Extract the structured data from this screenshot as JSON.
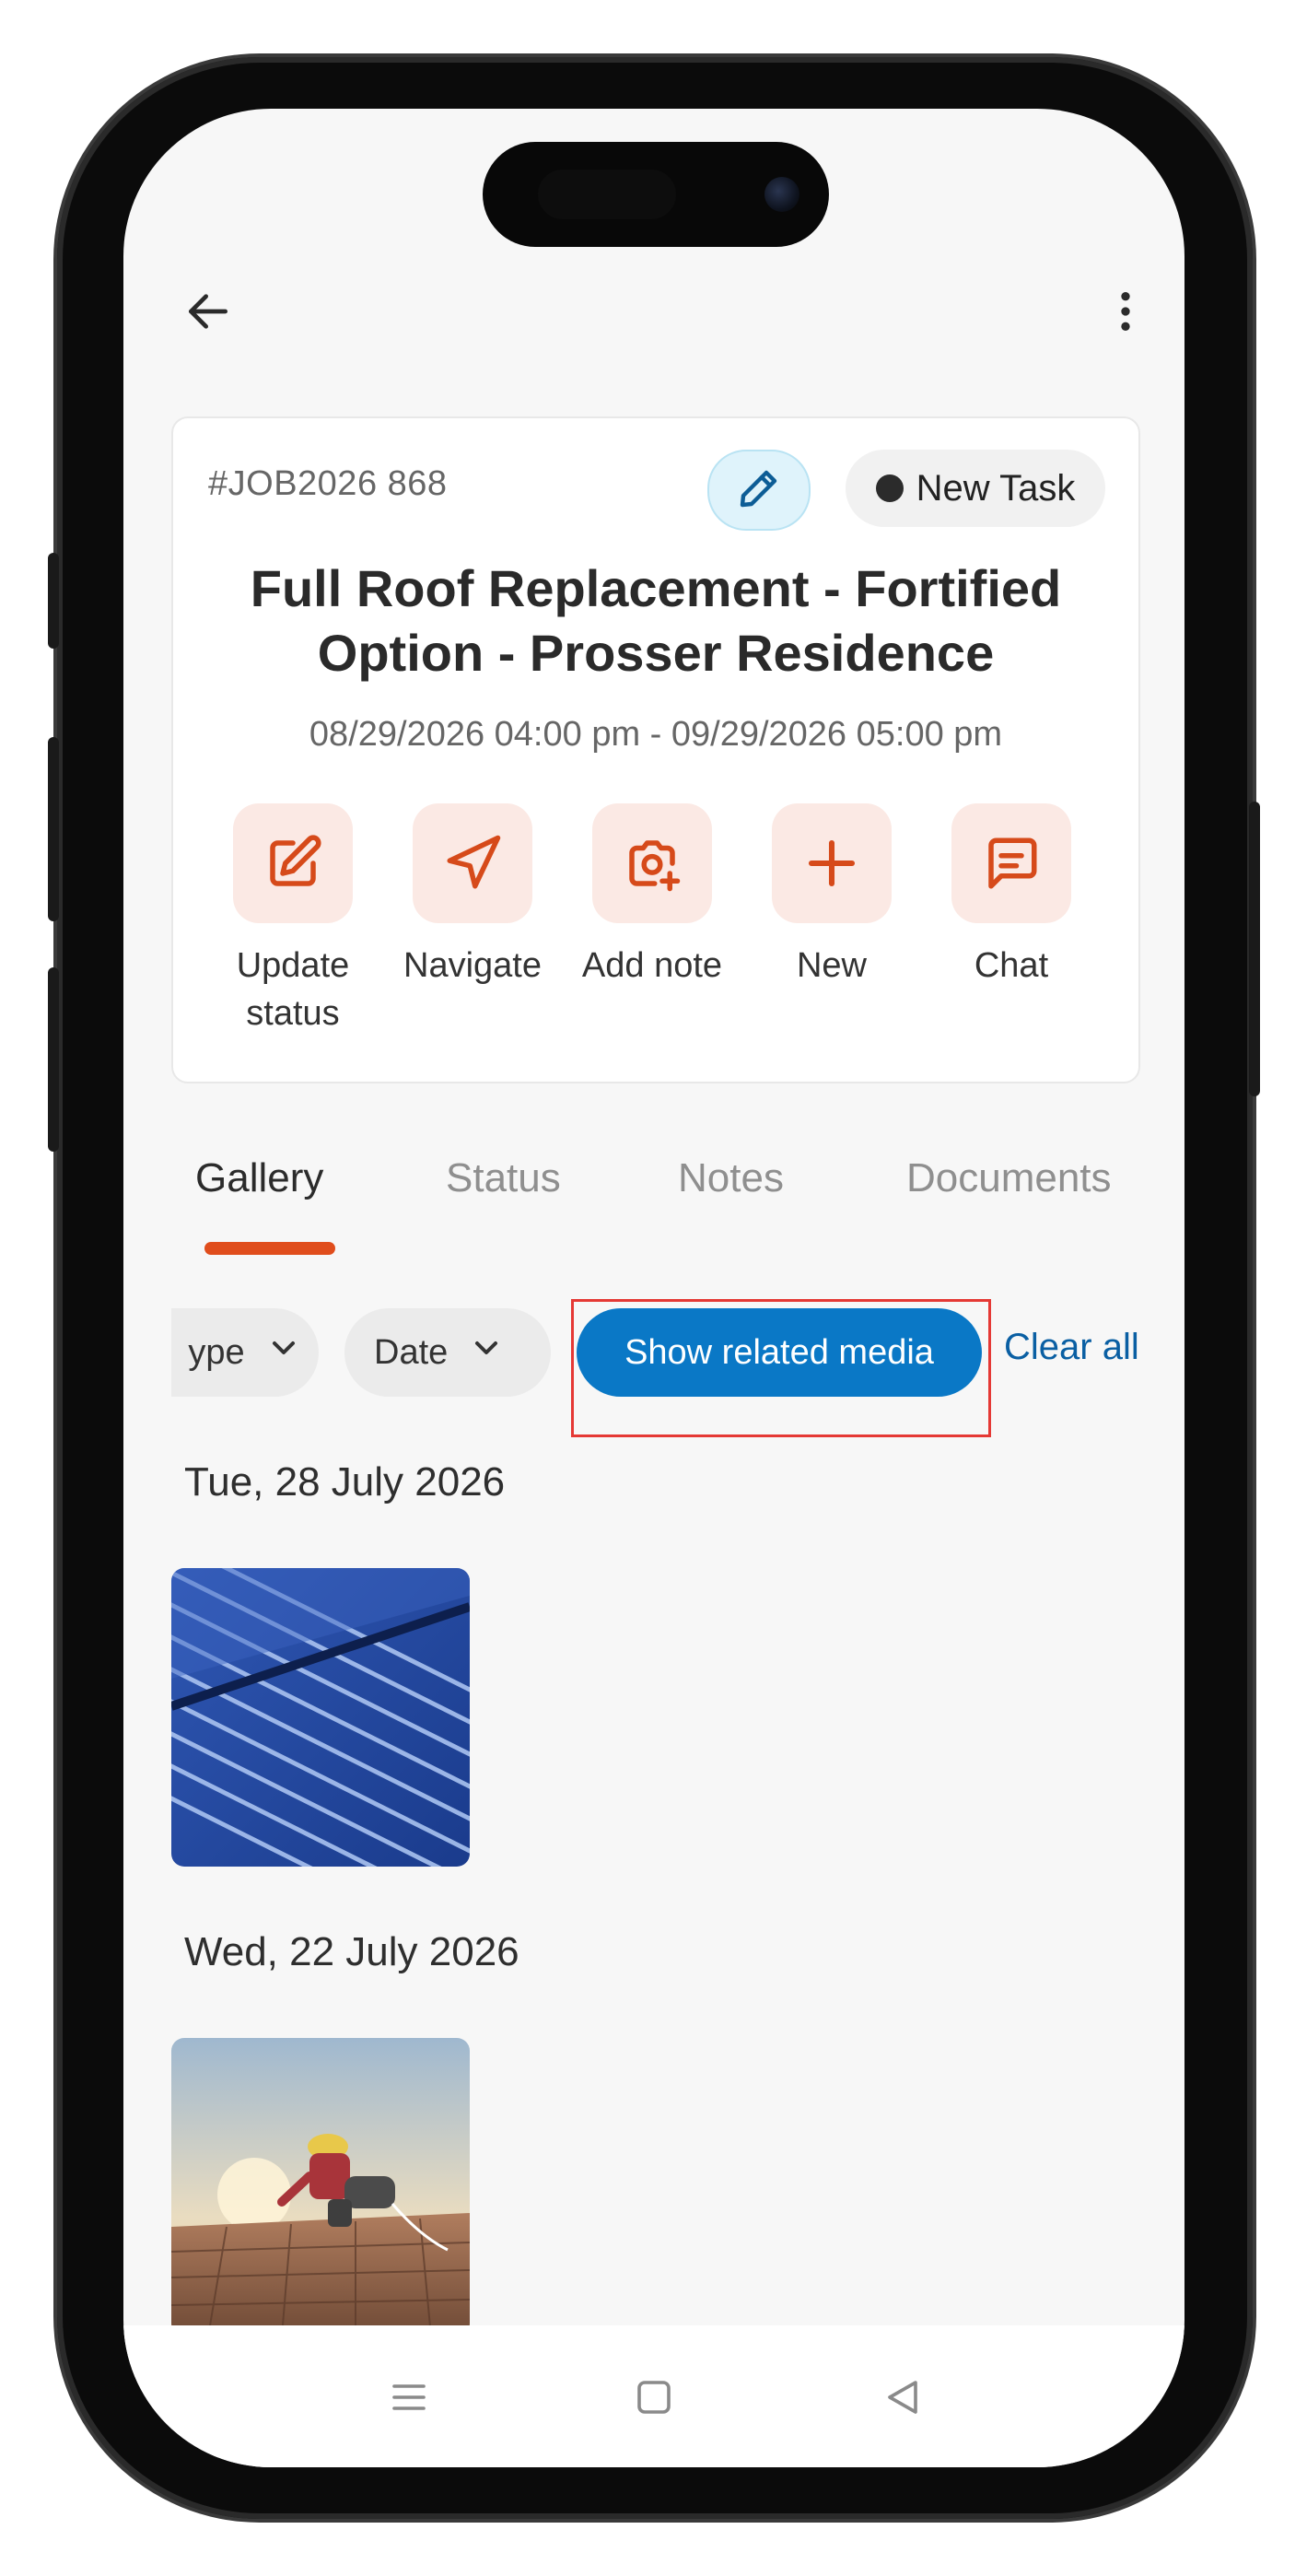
{
  "header": {
    "back_icon": "arrow-left-icon",
    "menu_icon": "more-vertical-icon"
  },
  "job": {
    "id": "#JOB2026 868",
    "status": "New Task",
    "title": "Full Roof Replacement - Fortified Option - Prosser Residence",
    "date_range": "08/29/2026 04:00 pm - 09/29/2026 05:00 pm"
  },
  "actions": [
    {
      "label": "Update status",
      "icon": "edit-square-icon"
    },
    {
      "label": "Navigate",
      "icon": "navigation-icon"
    },
    {
      "label": "Add note",
      "icon": "camera-plus-icon"
    },
    {
      "label": "New",
      "icon": "plus-icon"
    },
    {
      "label": "Chat",
      "icon": "chat-bubble-icon"
    }
  ],
  "tabs": [
    "Gallery",
    "Status",
    "Notes",
    "Documents"
  ],
  "filters": {
    "type_label": "ype",
    "date_label": "Date",
    "show_related": "Show related media",
    "clear_all": "Clear all"
  },
  "gallery": [
    {
      "date": "Tue, 28 July 2026"
    },
    {
      "date": "Wed, 22 July 2026"
    }
  ],
  "colors": {
    "accent": "#e04d1c",
    "primary": "#0a78c6",
    "action_bg": "#fbe9e4"
  }
}
